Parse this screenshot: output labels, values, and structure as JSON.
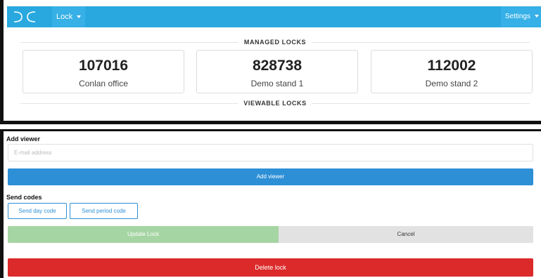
{
  "navbar": {
    "logo_icon": "dc-logo-icon",
    "lock_menu_label": "Lock",
    "settings_menu_label": "Settings",
    "color": "#29a8e0"
  },
  "managed_section": {
    "heading": "MANAGED LOCKS",
    "locks": [
      {
        "code": "107016",
        "name": "Conlan office"
      },
      {
        "code": "828738",
        "name": "Demo stand 1"
      },
      {
        "code": "112002",
        "name": "Demo stand 2"
      }
    ]
  },
  "viewable_section": {
    "heading": "VIEWABLE LOCKS"
  },
  "add_viewer": {
    "label": "Add viewer",
    "email_placeholder": "E-mail address",
    "button_label": "Add viewer"
  },
  "send_codes": {
    "label": "Send codes",
    "day_code_label": "Send day code",
    "period_code_label": "Send period code"
  },
  "actions": {
    "update_label": "Update Lock",
    "cancel_label": "Cancel",
    "delete_label": "Delete lock"
  },
  "colors": {
    "primary": "#2d8fd6",
    "success_disabled": "#a6d5a4",
    "danger": "#dc2a2a"
  }
}
